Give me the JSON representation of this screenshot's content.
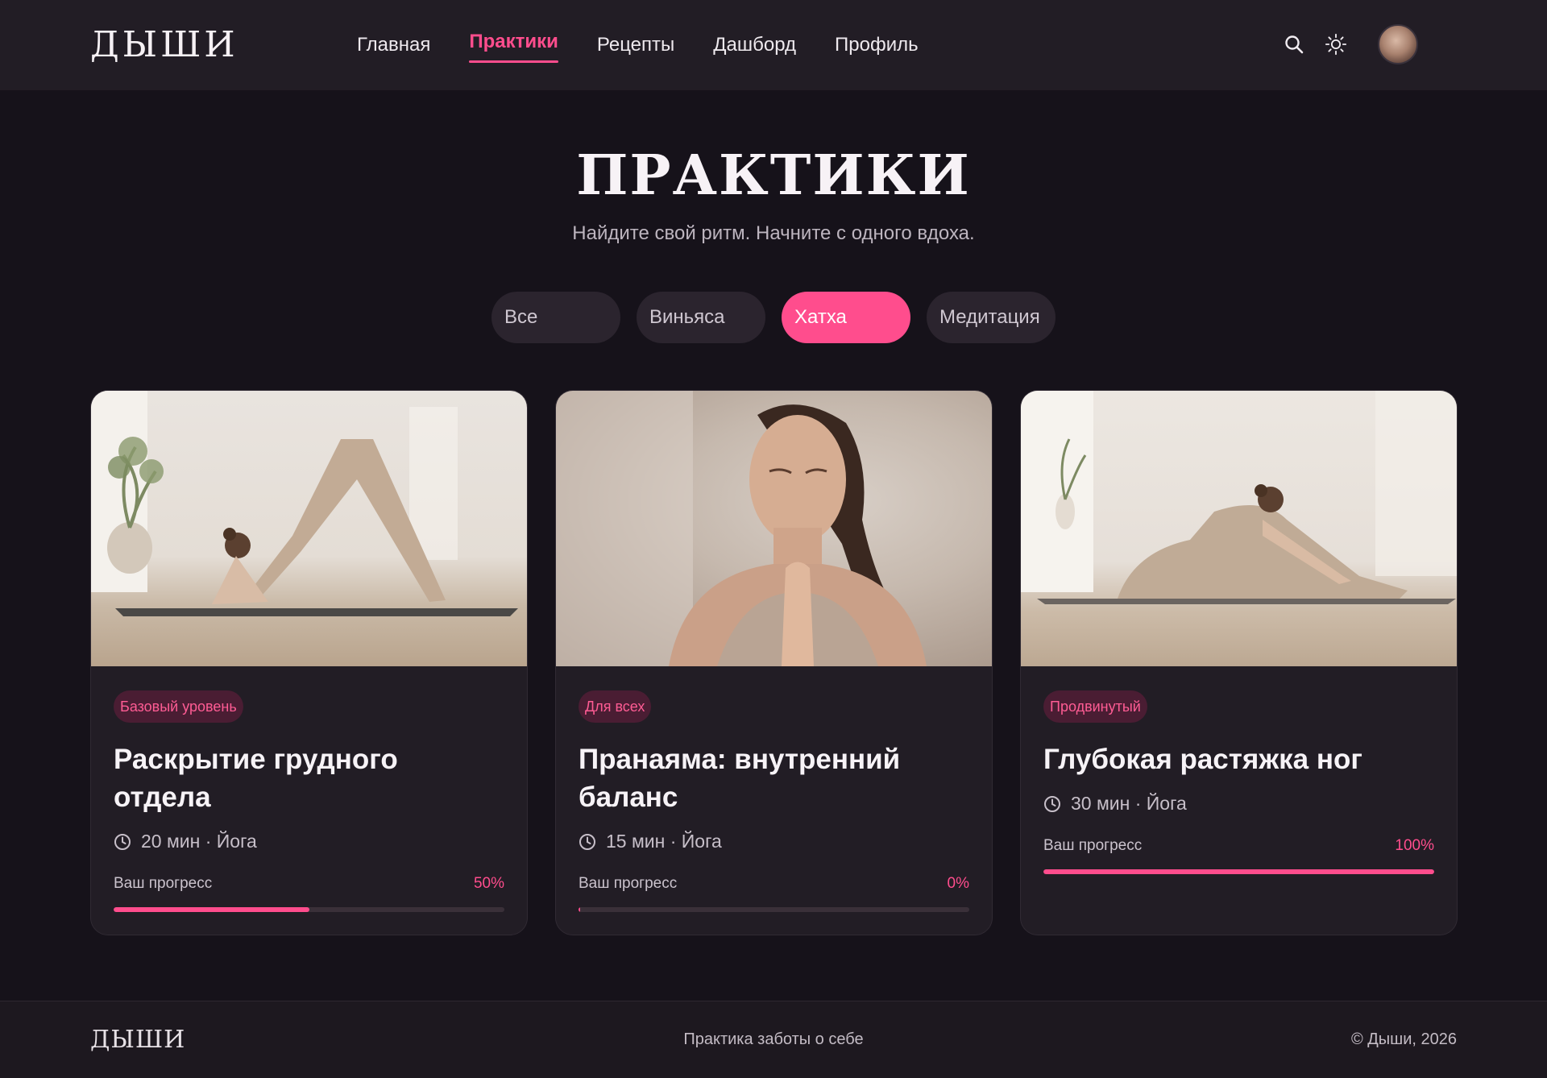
{
  "brand": {
    "logo": "ДЫШИ"
  },
  "nav": {
    "items": [
      {
        "label": "Главная",
        "active": false
      },
      {
        "label": "Практики",
        "active": true
      },
      {
        "label": "Рецепты",
        "active": false
      },
      {
        "label": "Дашборд",
        "active": false
      },
      {
        "label": "Профиль",
        "active": false
      }
    ]
  },
  "header": {
    "icons": [
      "search-icon",
      "sun-icon",
      "avatar"
    ]
  },
  "hero": {
    "title": "ПРАКТИКИ",
    "subtitle": "Найдите свой ритм. Начните с одного вдоха."
  },
  "filters": {
    "items": [
      {
        "label": "Все",
        "active": false
      },
      {
        "label": "Виньяса",
        "active": false
      },
      {
        "label": "Хатха",
        "active": true
      },
      {
        "label": "Медитация",
        "active": false
      }
    ]
  },
  "cards": [
    {
      "badge": "Базовый уровень",
      "title": "Раскрытие грудного отдела",
      "meta": "20 мин · Йога",
      "progress_label": "Ваш прогресс",
      "progress_text": "50%",
      "progress": 0.5,
      "image": "yoga-downward-dog-photo"
    },
    {
      "badge": "Для всех",
      "title": "Пранаяма: внутренний баланс",
      "meta": "15 мин · Йога",
      "progress_label": "Ваш прогресс",
      "progress_text": "0%",
      "progress": 0.0,
      "image": "pranayama-meditation-photo"
    },
    {
      "badge": "Продвинутый",
      "title": "Глубокая растяжка ног",
      "meta": "30 мин · Йога",
      "progress_label": "Ваш прогресс",
      "progress_text": "100%",
      "progress": 1.0,
      "image": "seated-forward-fold-photo"
    }
  ],
  "footer": {
    "logo": "ДЫШИ",
    "tagline": "Практика заботы о себе",
    "copyright": "© Дыши, 2026"
  },
  "colors": {
    "accent": "#ff4d8d",
    "background": "#16121a",
    "surface": "#221d25"
  }
}
